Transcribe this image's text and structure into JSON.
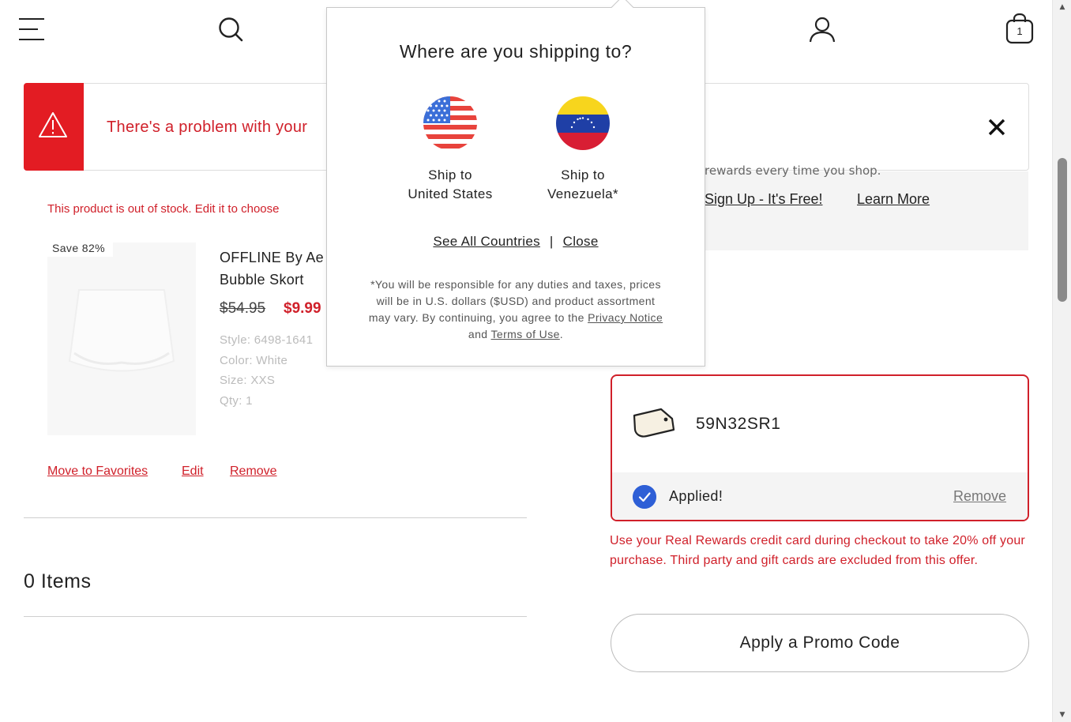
{
  "header": {
    "icons": [
      "hamburger-menu-icon",
      "search-icon",
      "account-icon",
      "shopping-bag-icon"
    ],
    "bag_count": "1"
  },
  "banner": {
    "message": "There's a problem with your",
    "icon": "warning-icon",
    "close_icon": "close-icon",
    "accent_color": "#e31c23"
  },
  "rewards": {
    "partial_text": "rewards every time you shop.",
    "signup_link": "Sign Up - It's Free!",
    "learn_more_link": "Learn More"
  },
  "product": {
    "out_of_stock_msg": "This product is out of stock. Edit it to choose",
    "save_badge": "Save 82%",
    "title_line1": "OFFLINE By Ae",
    "title_line2": "Bubble Skort",
    "old_price": "$54.95",
    "new_price": "$9.99",
    "style": "Style: 6498-1641",
    "color": "Color: White",
    "size": "Size: XXS",
    "qty": "Qty: 1",
    "actions": {
      "move_to_favorites": "Move to Favorites",
      "edit": "Edit",
      "remove": "Remove"
    }
  },
  "items_count": "0 Items",
  "coupon": {
    "code": "59N32SR1",
    "applied_label": "Applied!",
    "remove_label": "Remove"
  },
  "offer_text": "Use your Real Rewards credit card during checkout to take 20% off your purchase. Third party and gift cards are excluded from this offer.",
  "promo_button": "Apply a Promo Code",
  "popup": {
    "title": "Where are you shipping to?",
    "options": [
      {
        "line1": "Ship to",
        "line2": "United States",
        "flag": "us-flag-icon"
      },
      {
        "line1": "Ship to",
        "line2": "Venezuela*",
        "flag": "venezuela-flag-icon"
      }
    ],
    "see_all": "See All Countries",
    "separator": "|",
    "close": "Close",
    "fine_print_before": "*You will be responsible for any duties and taxes, prices will be in U.S. dollars ($USD) and product assortment may vary. By continuing, you agree to the",
    "privacy_link": "Privacy Notice",
    "fine_and": "and",
    "terms_link": "Terms of Use",
    "fine_end": "."
  },
  "colors": {
    "brand_red": "#d0202a",
    "check_blue": "#2e5fd6"
  }
}
